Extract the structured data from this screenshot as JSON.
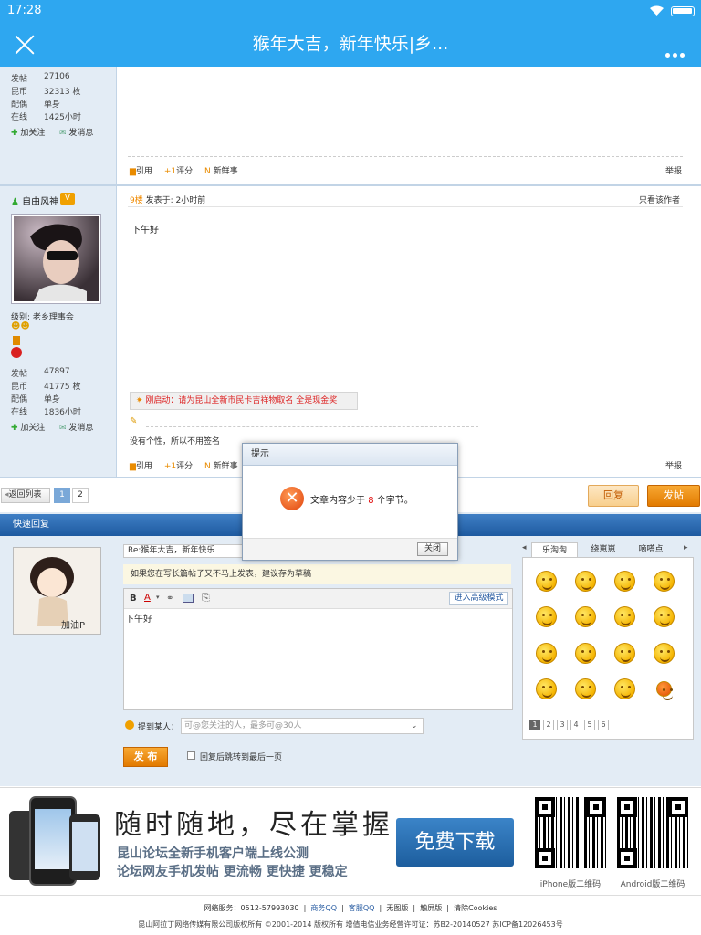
{
  "status_bar": {
    "time": "17:28"
  },
  "title_bar": {
    "title": "猴年大吉，新年快乐|乡...",
    "close_icon": "close-icon",
    "more_icon": "more-dots-icon"
  },
  "post1": {
    "stats": [
      {
        "k": "发帖",
        "v": "27106"
      },
      {
        "k": "昆币",
        "v": "32313 枚"
      },
      {
        "k": "配偶",
        "v": "单身"
      },
      {
        "k": "在线",
        "v": "1425小时"
      }
    ],
    "follow": "加关注",
    "message": "发消息",
    "actions": {
      "quote": "引用",
      "rate": "评分",
      "fresh": "新鲜事",
      "report": "举报"
    }
  },
  "post2": {
    "username": "自由风神",
    "vip_badge": "V",
    "floor": "9楼",
    "posted": "发表于: 2小时前",
    "only_author": "只看该作者",
    "content": "下午好",
    "level": "级别: 老乡理事会",
    "stats": [
      {
        "k": "发帖",
        "v": "47897"
      },
      {
        "k": "昆币",
        "v": "41775 枚"
      },
      {
        "k": "配偶",
        "v": "单身"
      },
      {
        "k": "在线",
        "v": "1836小时"
      }
    ],
    "follow": "加关注",
    "message": "发消息",
    "promo": "刚启动：请为昆山全新市民卡吉祥物取名 全是现金奖",
    "signature": "没有个性，所以不用签名",
    "actions": {
      "quote": "引用",
      "rate": "评分",
      "fresh": "新鲜事",
      "report": "举报"
    }
  },
  "pager": {
    "back": "返回列表",
    "pages": [
      "1",
      "2"
    ],
    "reply": "回复",
    "post": "发帖"
  },
  "quick_reply": {
    "header": "快速回复",
    "title_value": "Re:猴年大吉，新年快乐",
    "tip": "如果您在写长篇帖子又不马上发表，建议存为草稿",
    "advanced": "进入高级模式",
    "editor_text": "下午好",
    "mention_label": "提到某人：",
    "mention_placeholder": "可@您关注的人，最多可@30人",
    "submit": "发 布",
    "jump_label": "回复后跳转到最后一页",
    "avatar_caption": "加油P"
  },
  "emoji_panel": {
    "tabs": [
      "乐淘淘",
      "绕崽崽",
      "嘀嗒点"
    ],
    "pages": [
      "1",
      "2",
      "3",
      "4",
      "5",
      "6"
    ]
  },
  "dialog": {
    "title": "提示",
    "message_pre": "文章内容少于 ",
    "count": "8",
    "message_post": " 个字节。",
    "close": "关闭"
  },
  "banner": {
    "slogan": "随时随地，尽在掌握",
    "line1": "昆山论坛全新手机客户端上线公测",
    "line2": "论坛网友手机发帖 更流畅 更快捷 更稳定",
    "download": "免费下载",
    "qr1_caption": "iPhone版二维码",
    "qr2_caption": "Android版二维码"
  },
  "footer": {
    "line1": [
      "网络服务：0512-57993030",
      "商务QQ",
      "客服QQ",
      "无图版",
      "触屏版",
      "清除Cookies"
    ],
    "line2": "昆山阿拉丁网络传媒有限公司版权所有 ©2001-2014 版权所有 增值电信业务经营许可证：苏B2-20140527 苏ICP备12026453号"
  },
  "colors": {
    "blue": "#2ea7f0",
    "orange": "#f08a00",
    "red": "#e01010"
  }
}
